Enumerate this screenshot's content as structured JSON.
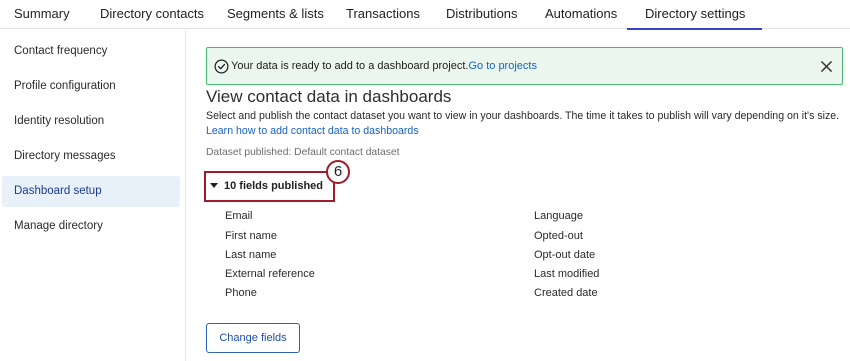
{
  "tabs": [
    {
      "label": "Summary"
    },
    {
      "label": "Directory contacts"
    },
    {
      "label": "Segments & lists"
    },
    {
      "label": "Transactions"
    },
    {
      "label": "Distributions"
    },
    {
      "label": "Automations"
    },
    {
      "label": "Directory settings",
      "active": true
    }
  ],
  "sidebar": {
    "items": [
      {
        "label": "Contact frequency"
      },
      {
        "label": "Profile configuration"
      },
      {
        "label": "Identity resolution"
      },
      {
        "label": "Directory messages"
      },
      {
        "label": "Dashboard setup",
        "active": true
      },
      {
        "label": "Manage directory"
      }
    ]
  },
  "banner": {
    "message": "Your data is ready to add to a dashboard project.",
    "link_label": "Go to projects",
    "icon": "check-circle-icon",
    "close_icon": "close-icon",
    "color": "#4bb870"
  },
  "main": {
    "title": "View contact data in dashboards",
    "description": "Select and publish the contact dataset you want to view in your dashboards. The time it takes to publish will vary depending on it's size.",
    "learn_link": "Learn how to add contact data to dashboards",
    "dataset_status": "Dataset published: Default contact dataset",
    "fields_toggle": "10 fields published",
    "step_number": "6",
    "fields_left": [
      "Email",
      "First name",
      "Last name",
      "External reference",
      "Phone"
    ],
    "fields_right": [
      "Language",
      "Opted-out",
      "Opt-out date",
      "Last modified",
      "Created date"
    ],
    "change_button": "Change fields"
  },
  "colors": {
    "accent": "#3b44c6",
    "link": "#1763c6",
    "highlight": "#a01b2c"
  }
}
